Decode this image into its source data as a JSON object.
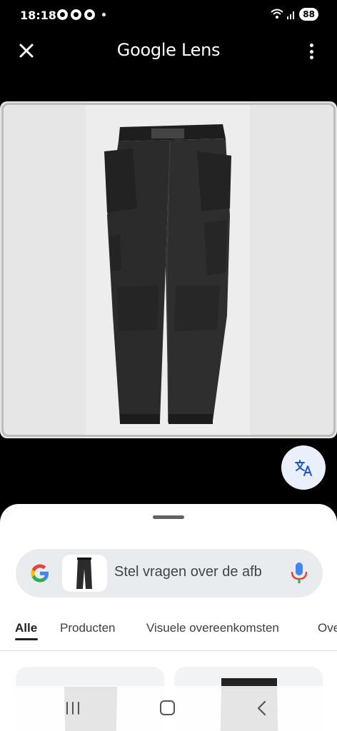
{
  "status_bar": {
    "time": "18:18",
    "battery": "88",
    "icons": [
      "whatsapp-icon",
      "messenger-icon",
      "messenger-icon",
      "wifi-icon",
      "signal-icon"
    ]
  },
  "header": {
    "title": "Google Lens",
    "close_icon": "close-icon",
    "menu_icon": "more-vert-icon"
  },
  "image": {
    "description_icon": "pants-image",
    "background": "#e6e6e6"
  },
  "translate_button": {
    "icon": "translate-icon",
    "color": "#1a56c4"
  },
  "search": {
    "placeholder": "Stel vragen over de afb",
    "icon": "google-g-logo",
    "mic_icon": "mic-icon"
  },
  "tabs": [
    {
      "label": "Alle",
      "active": true
    },
    {
      "label": "Producten",
      "active": false
    },
    {
      "label": "Visuele overeenkomsten",
      "active": false
    },
    {
      "label": "Ove",
      "active": false
    }
  ],
  "nav": {
    "recent_icon": "recent-apps-icon",
    "home_icon": "home-icon",
    "back_icon": "back-icon"
  }
}
